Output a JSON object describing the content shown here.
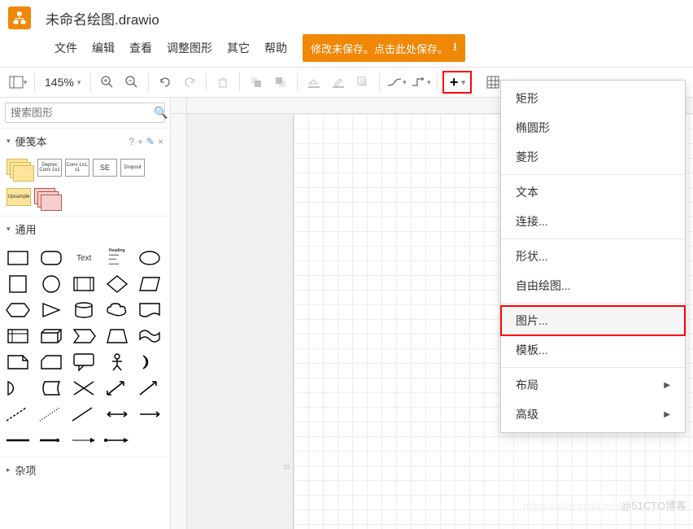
{
  "app": {
    "filename": "未命名绘图.drawio"
  },
  "menu": {
    "items": [
      "文件",
      "编辑",
      "查看",
      "调整图形",
      "其它",
      "帮助"
    ],
    "save_warning": "修改未保存。点击此处保存。"
  },
  "toolbar": {
    "zoom": "145%",
    "buttons": {
      "fit": "fit-page",
      "zoom_in": "zoom-in",
      "zoom_out": "zoom-out",
      "undo": "undo",
      "redo": "redo",
      "delete": "delete",
      "to_front": "to-front",
      "to_back": "to-back",
      "fill": "fill-color",
      "line": "line-color",
      "shadow": "shadow",
      "connection": "connection",
      "waypoint": "waypoint",
      "insert": "insert",
      "table": "table"
    }
  },
  "sidebar": {
    "search_placeholder": "搜索图形",
    "scratchpad": {
      "title": "便笺本",
      "tools": [
        "?",
        "+",
        "✎",
        "×"
      ],
      "items": [
        "",
        "Deprec Conv 1x1",
        "Conv 1x1, s1",
        "SE",
        "Dropout",
        "Upsample"
      ]
    },
    "general": {
      "title": "通用",
      "text_label": "Text",
      "heading_label": "Heading"
    },
    "misc": {
      "title": "杂项"
    }
  },
  "dropdown": {
    "groups": [
      {
        "items": [
          {
            "label": "矩形",
            "key": "rect"
          },
          {
            "label": "椭圆形",
            "key": "ellipse"
          },
          {
            "label": "菱形",
            "key": "rhombus"
          }
        ]
      },
      {
        "items": [
          {
            "label": "文本",
            "key": "text"
          },
          {
            "label": "连接...",
            "key": "link"
          }
        ]
      },
      {
        "items": [
          {
            "label": "形状...",
            "key": "shape"
          },
          {
            "label": "自由绘图...",
            "key": "freehand"
          }
        ]
      },
      {
        "items": [
          {
            "label": "图片...",
            "key": "image",
            "highlight": true
          },
          {
            "label": "模板...",
            "key": "template"
          }
        ]
      },
      {
        "items": [
          {
            "label": "布局",
            "key": "layout",
            "submenu": true
          },
          {
            "label": "高级",
            "key": "advanced",
            "submenu": true
          }
        ]
      }
    ]
  },
  "watermark": {
    "faint": "https://blog.csdn.net/",
    "main": "@51CTO博客"
  }
}
